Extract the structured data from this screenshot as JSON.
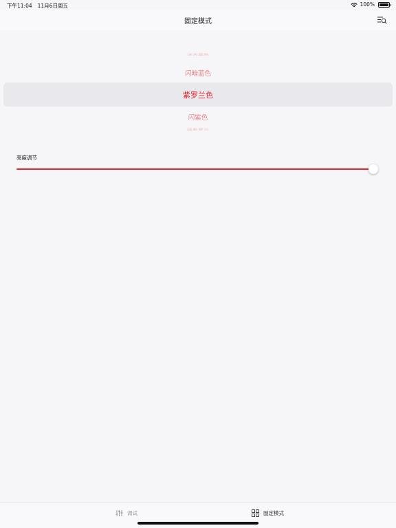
{
  "status_bar": {
    "time": "下午11:04",
    "date": "11月6日周五",
    "battery": "100%"
  },
  "nav": {
    "title": "固定模式",
    "menu_icon": "list-search-icon"
  },
  "picker": {
    "items": [
      {
        "label": "深天蓝色",
        "state": "far"
      },
      {
        "label": "闪暗蓝色",
        "state": "near"
      },
      {
        "label": "紫罗兰色",
        "state": "selected"
      },
      {
        "label": "闪紫色",
        "state": "near"
      },
      {
        "label": "暗紫罗兰",
        "state": "far"
      }
    ],
    "accent_color": "#e0242c"
  },
  "brightness": {
    "label": "亮度调节",
    "value": 1.0
  },
  "tabs": [
    {
      "label": "调试",
      "icon": "sliders-icon",
      "active": false
    },
    {
      "label": "固定模式",
      "icon": "grid-icon",
      "active": true
    }
  ]
}
